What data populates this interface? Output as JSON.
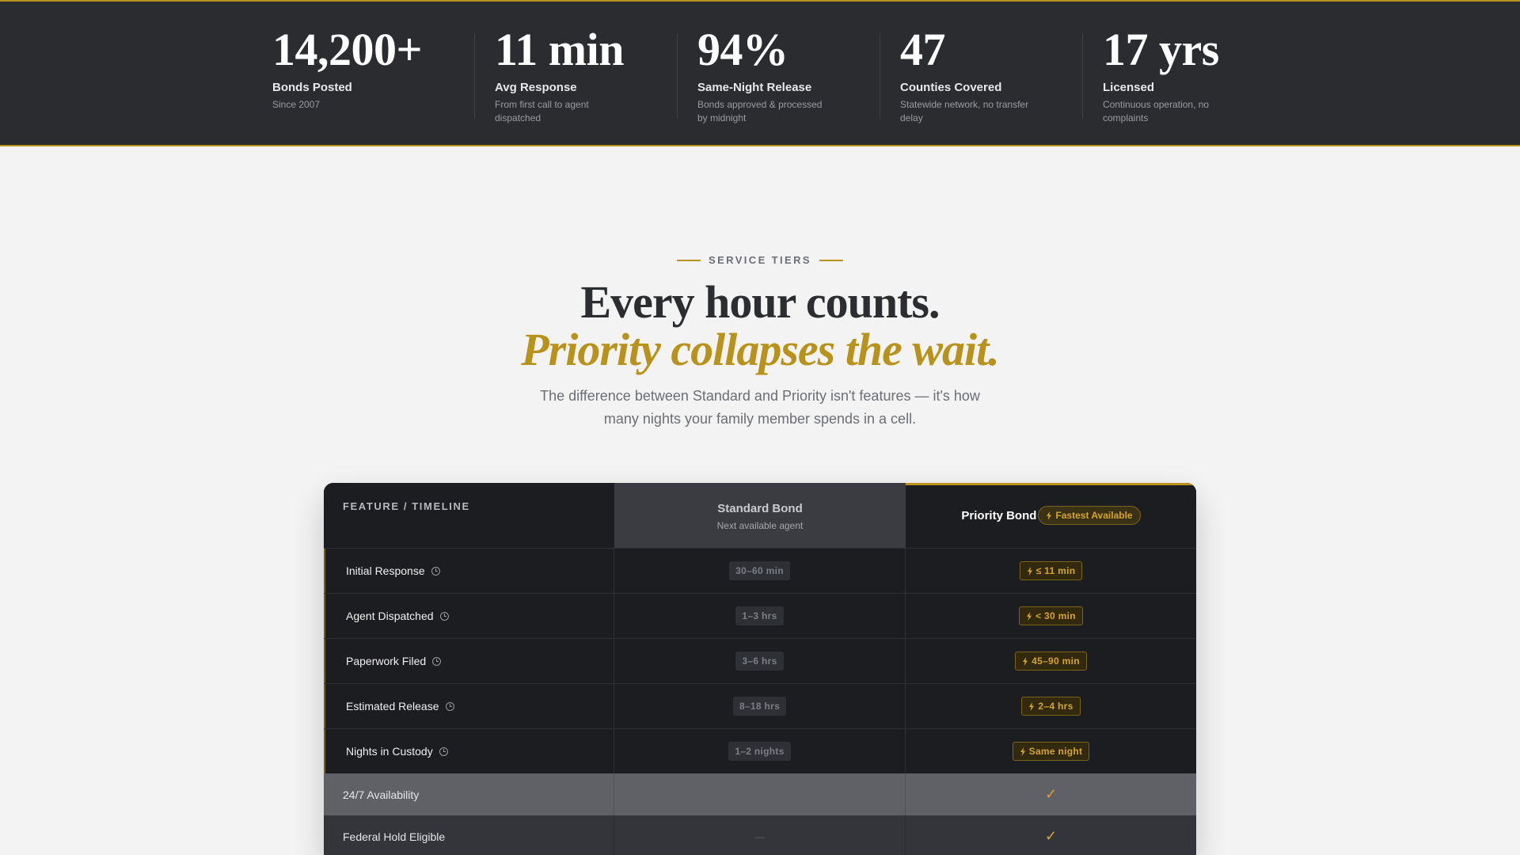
{
  "stats": [
    {
      "value": "14,200+",
      "label": "Bonds Posted",
      "desc": "Since 2007"
    },
    {
      "value": "11 min",
      "label": "Avg Response",
      "desc": "From first call to agent dispatched"
    },
    {
      "value": "94%",
      "label": "Same-Night Release",
      "desc": "Bonds approved & processed by midnight"
    },
    {
      "value": "47",
      "label": "Counties Covered",
      "desc": "Statewide network, no transfer delay"
    },
    {
      "value": "17 yrs",
      "label": "Licensed",
      "desc": "Continuous operation, no complaints"
    }
  ],
  "hero": {
    "eyebrow": "SERVICE TIERS",
    "headline": "Every hour counts.",
    "headline_accent": "Priority collapses the wait.",
    "subcopy": "The difference between Standard and Priority isn't features — it's how many nights your family member spends in a cell."
  },
  "table": {
    "feature_header": "FEATURE / TIMELINE",
    "standard": {
      "title": "Standard Bond",
      "sub": "Next available agent"
    },
    "priority": {
      "title": "Priority Bond",
      "badge": "Fastest Available"
    },
    "timeline_rows": [
      {
        "feature": "Initial Response",
        "standard": "30–60 min",
        "priority": "≤ 11 min"
      },
      {
        "feature": "Agent Dispatched",
        "standard": "1–3 hrs",
        "priority": "< 30 min"
      },
      {
        "feature": "Paperwork Filed",
        "standard": "3–6 hrs",
        "priority": "45–90 min"
      },
      {
        "feature": "Estimated Release",
        "standard": "8–18 hrs",
        "priority": "2–4 hrs"
      },
      {
        "feature": "Nights in Custody",
        "standard": "1–2 nights",
        "priority": "Same night"
      }
    ],
    "feature_rows": [
      {
        "feature": "24/7 Availability",
        "standard": "",
        "priority": "✓"
      },
      {
        "feature": "Federal Hold Eligible",
        "standard": "—",
        "priority": "✓"
      }
    ]
  },
  "colors": {
    "accent": "#b8921a",
    "band": "#2a2c30",
    "table": "#1c1d20"
  }
}
